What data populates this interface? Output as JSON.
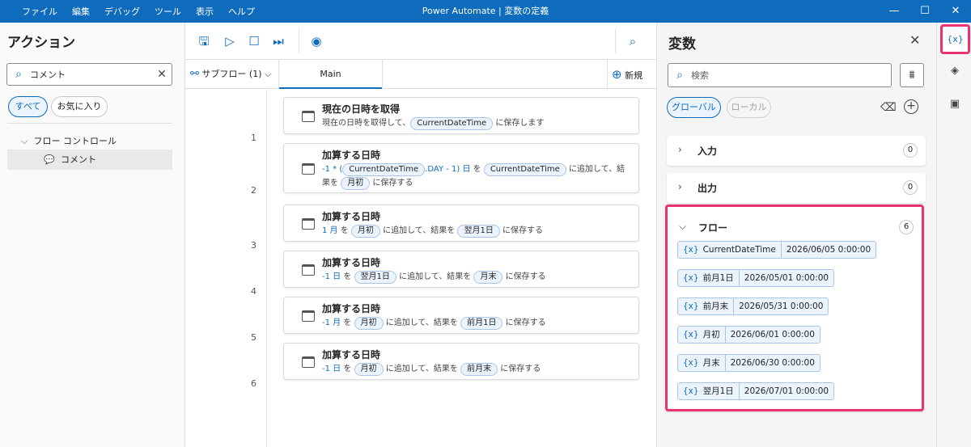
{
  "titlebar": {
    "menu": [
      "ファイル",
      "編集",
      "デバッグ",
      "ツール",
      "表示",
      "ヘルプ"
    ],
    "title": "Power Automate | 変数の定義",
    "min": "—",
    "max": "☐",
    "close": "✕"
  },
  "actions_panel": {
    "title": "アクション",
    "search_value": "コメント",
    "filter_all": "すべて",
    "filter_fav": "お気に入り",
    "tree_group": "フロー コントロール",
    "tree_item": "コメント"
  },
  "tabs": {
    "subflow": "サブフロー (1)",
    "main": "Main",
    "new": "新規"
  },
  "steps": [
    {
      "num": "1",
      "title": "現在の日時を取得",
      "desc": [
        "現在の日時を取得して、",
        {
          "chip": "CurrentDateTime"
        },
        " に保存します"
      ]
    },
    {
      "num": "2",
      "title": "加算する日時",
      "desc": [
        {
          "blue": "-1 * ("
        },
        {
          "chip": "CurrentDateTime"
        },
        {
          "blue": ".DAY - 1) 日"
        },
        " を ",
        {
          "chip": "CurrentDateTime"
        },
        " に追加して、結果を ",
        {
          "chip": "月初"
        },
        " に保存する"
      ]
    },
    {
      "num": "3",
      "title": "加算する日時",
      "desc": [
        {
          "blue": "1 月"
        },
        " を ",
        {
          "chip": "月初"
        },
        " に追加して、結果を ",
        {
          "chip": "翌月1日"
        },
        " に保存する"
      ]
    },
    {
      "num": "4",
      "title": "加算する日時",
      "desc": [
        {
          "blue": "-1 日"
        },
        " を ",
        {
          "chip": "翌月1日"
        },
        " に追加して、結果を ",
        {
          "chip": "月末"
        },
        " に保存する"
      ]
    },
    {
      "num": "5",
      "title": "加算する日時",
      "desc": [
        {
          "blue": "-1 月"
        },
        " を ",
        {
          "chip": "月初"
        },
        " に追加して、結果を ",
        {
          "chip": "前月1日"
        },
        " に保存する"
      ]
    },
    {
      "num": "6",
      "title": "加算する日時",
      "desc": [
        {
          "blue": "-1 日"
        },
        " を ",
        {
          "chip": "月初"
        },
        " に追加して、結果を ",
        {
          "chip": "前月末"
        },
        " に保存する"
      ]
    }
  ],
  "variables_panel": {
    "title": "変数",
    "search_placeholder": "検索",
    "scope_global": "グローバル",
    "scope_local": "ローカル",
    "input": {
      "label": "入力",
      "count": "0"
    },
    "output": {
      "label": "出力",
      "count": "0"
    },
    "flow": {
      "label": "フロー",
      "count": "6"
    },
    "variables": [
      {
        "name": "CurrentDateTime",
        "value": "2026/06/05 0:00:00"
      },
      {
        "name": "前月1日",
        "value": "2026/05/01 0:00:00"
      },
      {
        "name": "前月末",
        "value": "2026/05/31 0:00:00"
      },
      {
        "name": "月初",
        "value": "2026/06/01 0:00:00"
      },
      {
        "name": "月末",
        "value": "2026/06/30 0:00:00"
      },
      {
        "name": "翌月1日",
        "value": "2026/07/01 0:00:00"
      }
    ],
    "var_prefix": "{x}"
  },
  "strip": {
    "vars_label": "{x}"
  },
  "colors": {
    "accent": "#0f6cbd",
    "highlight": "#e8336f"
  }
}
